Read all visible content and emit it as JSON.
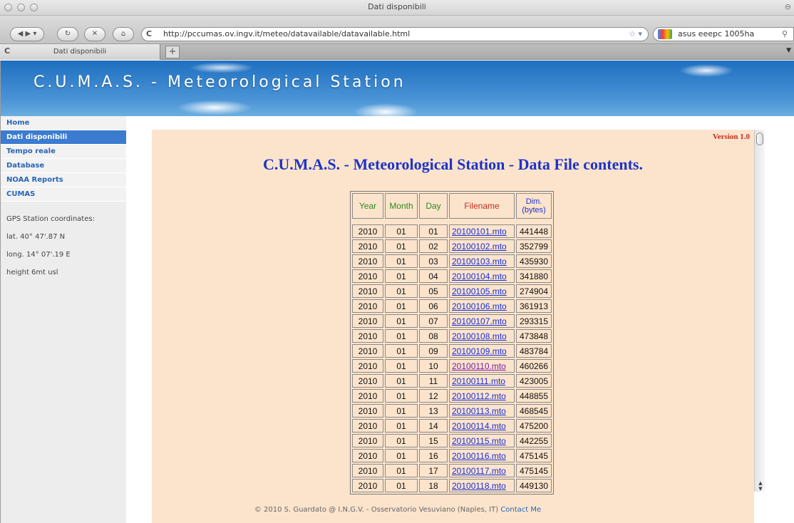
{
  "window": {
    "title": "Dati disponibili"
  },
  "toolbar": {
    "url": "http://pccumas.ov.ingv.it/meteo/datavailable/datavailable.html",
    "search_value": "asus eeepc 1005ha"
  },
  "tabs": [
    {
      "label": "Dati disponibili"
    }
  ],
  "banner": {
    "title": "C.U.M.A.S. - Meteorological Station"
  },
  "sidebar": {
    "nav": [
      {
        "label": "Home"
      },
      {
        "label": "Dati disponibili"
      },
      {
        "label": "Tempo reale"
      },
      {
        "label": "Database"
      },
      {
        "label": "NOAA Reports"
      },
      {
        "label": "CUMAS"
      }
    ],
    "gps": [
      "GPS Station coordinates:",
      "lat. 40° 47'.87 N",
      "long. 14° 07'.19 E",
      "height 6mt usl"
    ]
  },
  "main": {
    "version": "Version 1.0",
    "heading": "C.U.M.A.S. - Meteorological Station - Data File contents.",
    "columns": [
      "Year",
      "Month",
      "Day",
      "Filename",
      "Dim.",
      "(bytes)"
    ],
    "rows": [
      [
        "2010",
        "01",
        "01",
        "20100101.mto",
        "441448"
      ],
      [
        "2010",
        "01",
        "02",
        "20100102.mto",
        "352799"
      ],
      [
        "2010",
        "01",
        "03",
        "20100103.mto",
        "435930"
      ],
      [
        "2010",
        "01",
        "04",
        "20100104.mto",
        "341880"
      ],
      [
        "2010",
        "01",
        "05",
        "20100105.mto",
        "274904"
      ],
      [
        "2010",
        "01",
        "06",
        "20100106.mto",
        "361913"
      ],
      [
        "2010",
        "01",
        "07",
        "20100107.mto",
        "293315"
      ],
      [
        "2010",
        "01",
        "08",
        "20100108.mto",
        "473848"
      ],
      [
        "2010",
        "01",
        "09",
        "20100109.mto",
        "483784"
      ],
      [
        "2010",
        "01",
        "10",
        "20100110.mto",
        "460266"
      ],
      [
        "2010",
        "01",
        "11",
        "20100111.mto",
        "423005"
      ],
      [
        "2010",
        "01",
        "12",
        "20100112.mto",
        "448855"
      ],
      [
        "2010",
        "01",
        "13",
        "20100113.mto",
        "468545"
      ],
      [
        "2010",
        "01",
        "14",
        "20100114.mto",
        "475200"
      ],
      [
        "2010",
        "01",
        "15",
        "20100115.mto",
        "442255"
      ],
      [
        "2010",
        "01",
        "16",
        "20100116.mto",
        "475145"
      ],
      [
        "2010",
        "01",
        "17",
        "20100117.mto",
        "475145"
      ],
      [
        "2010",
        "01",
        "18",
        "20100118.mto",
        "449130"
      ]
    ]
  },
  "footer": {
    "text": "© 2010 S. Guardato @ I.N.G.V. - Osservatorio Vesuviano (Naples, IT)",
    "link": "Contact Me"
  },
  "icons": {
    "back": "back-icon",
    "forward": "forward-icon",
    "reload": "reload-icon",
    "stop": "stop-icon",
    "home": "home-icon",
    "bookmark": "star-icon",
    "search": "magnifier-icon",
    "newtab": "plus-icon"
  }
}
